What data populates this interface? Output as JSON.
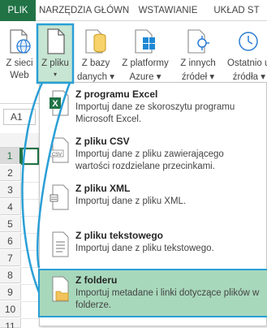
{
  "tabs": [
    {
      "label": "PLIK",
      "active": true
    },
    {
      "label": "NARZĘDZIA GŁÓWNE",
      "active": false
    },
    {
      "label": "WSTAWIANIE",
      "active": false
    },
    {
      "label": "UKŁAD ST",
      "active": false
    }
  ],
  "ribbon": {
    "buttons": [
      {
        "line1": "Z sieci",
        "line2": "Web",
        "icon": "globe-page-icon"
      },
      {
        "line1": "Z pliku",
        "line2": "▾",
        "icon": "file-icon",
        "selected": true
      },
      {
        "line1": "Z bazy",
        "line2": "danych ▾",
        "icon": "database-icon"
      },
      {
        "line1": "Z platformy",
        "line2": "Azure ▾",
        "icon": "azure-windows-icon"
      },
      {
        "line1": "Z innych",
        "line2": "źródeł ▾",
        "icon": "other-sources-icon"
      },
      {
        "line1": "Ostatnio uży",
        "line2": "źródła ▾",
        "icon": "recent-sources-icon"
      }
    ]
  },
  "sheet": {
    "name_box": "A1",
    "col_header_visible": "E",
    "rows": [
      "1",
      "2",
      "3",
      "4",
      "5",
      "6",
      "7",
      "8",
      "9",
      "10",
      "11"
    ]
  },
  "menu": {
    "items": [
      {
        "title": "Z programu Excel",
        "desc": "Importuj dane ze skoroszytu programu Microsoft Excel.",
        "icon": "excel-file-icon"
      },
      {
        "title": "Z pliku CSV",
        "desc": "Importuj dane z pliku zawierającego wartości rozdzielane przecinkami.",
        "icon": "csv-file-icon"
      },
      {
        "title": "Z pliku XML",
        "desc": "Importuj dane z pliku XML.",
        "icon": "xml-file-icon"
      },
      {
        "title": "Z pliku tekstowego",
        "desc": "Importuj dane z pliku tekstowego.",
        "icon": "text-file-icon"
      },
      {
        "title": "Z folderu",
        "desc": "Importuj metadane i linki dotyczące plików w folderze.",
        "icon": "folder-icon",
        "highlighted": true
      }
    ]
  },
  "colors": {
    "excel_green": "#217346",
    "highlight_green": "#a8d8bb",
    "callout_blue": "#2a9fd6"
  }
}
